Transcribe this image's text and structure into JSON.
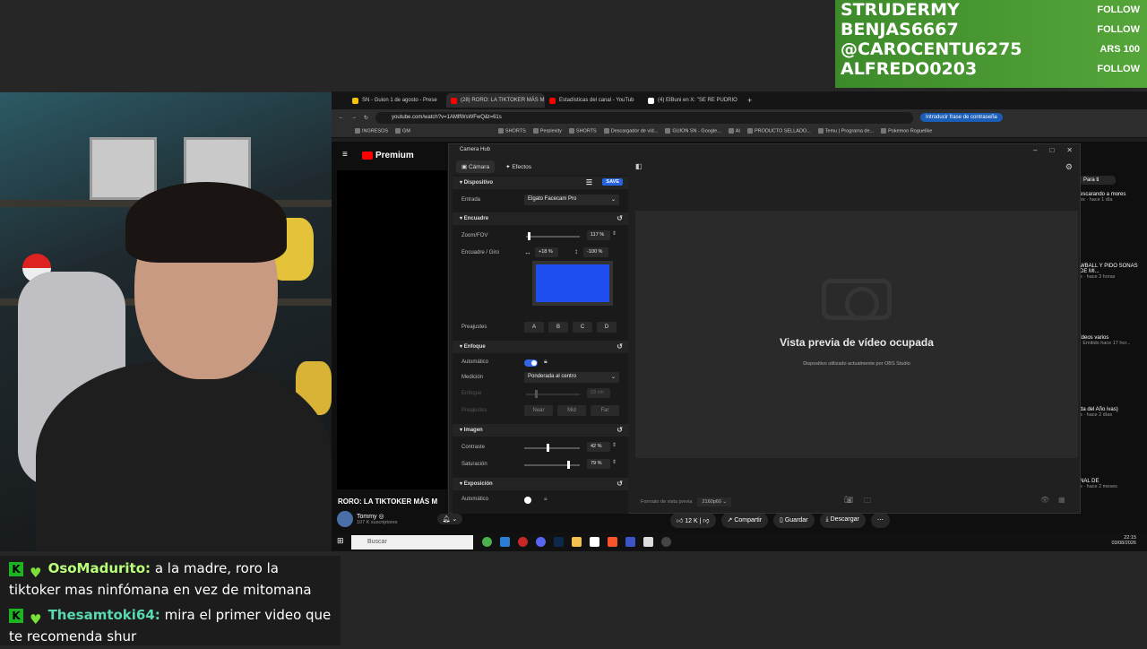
{
  "alerts": [
    {
      "name": "STRUDERMY",
      "action": "FOLLOW"
    },
    {
      "name": "BENJAS6667",
      "action": "FOLLOW"
    },
    {
      "name": "@CAROCENTU6275",
      "action": "ARS 100"
    },
    {
      "name": "ALFREDO0203",
      "action": "FOLLOW"
    }
  ],
  "chat": [
    {
      "badge": "K",
      "user": "OsoMadurito:",
      "msg": "a la madre, roro la tiktoker mas ninfómana en vez de mitomana"
    },
    {
      "badge": "K",
      "user": "Thesamtoki64:",
      "msg": "mira el primer video que te recomenda shur"
    }
  ],
  "browser": {
    "tabs": [
      {
        "label": "SN - Guion 1 de agosto - Prese",
        "color": "#f4c20d"
      },
      {
        "label": "(28) RORO: LA TIKTOKER MÁS M",
        "color": "#ff0000",
        "active": true
      },
      {
        "label": "Estadísticas del canal - YouTub",
        "color": "#ff0000"
      },
      {
        "label": "(4) ElBuni en X: \"SE RE PUDRIO",
        "color": "#ffffff"
      }
    ],
    "url": "youtube.com/watch?v=1AMlfWsWFwQ&t=61s",
    "translate_pill": "Introducir frase de contraseña",
    "bookmarks": [
      "INGRESOS",
      "GM",
      "SHORTS",
      "Perplexity",
      "SHORTS",
      "Descargador de víd...",
      "GUION SN - Google...",
      "AI",
      "PRODUCTO SELLADO...",
      "Temu | Programa de...",
      "Pokemon Roguelike"
    ]
  },
  "youtube": {
    "logo": "Premium",
    "video_title": "RORO: LA TIKTOKER MÁS M",
    "channel": "Tommy ◎",
    "subs": "107 K suscriptores",
    "likes": "12 K",
    "share": "Compartir",
    "save": "Guardar",
    "download": "Descargar",
    "for_you": "Para ti",
    "sidebar": [
      {
        "title": "escarando a mores",
        "meta": "es · hace 1 día"
      },
      {
        "title": "WBALL Y PIDO SONAS DE MI...",
        "meta": "s · hace 3 horas"
      },
      {
        "title": "ídeos varios",
        "meta": "· Emitido hace 17 hor..."
      },
      {
        "title": "da del Año ivas)",
        "meta": "s · hace 2 días"
      },
      {
        "title": "NAL DE",
        "meta": "s · hace 2 meses"
      }
    ]
  },
  "camera_hub": {
    "title": "Camera Hub",
    "tab_camera": "Cámara",
    "tab_effects": "Efectos",
    "section_device": "Dispositivo",
    "save": "SAVE",
    "input_label": "Entrada",
    "input_value": "Elgato Facecam Pro",
    "section_framing": "Encuadre",
    "zoom_label": "Zoom/FOV",
    "zoom_value": "117 %",
    "zoom_level": 0.05,
    "pan_label": "Encuadre / Giro",
    "pan_value": "+18 %",
    "tilt_value": "-100 %",
    "presets_label": "Preajustes",
    "presets": [
      "A",
      "B",
      "C",
      "D"
    ],
    "section_focus": "Enfoque",
    "auto_label": "Automático",
    "metering_label": "Medición",
    "metering_value": "Ponderada al centro",
    "focus_label": "Enfoque",
    "focus_value": "23 cm",
    "focus_presets_label": "Preajustes",
    "focus_presets": [
      "Near",
      "Mid",
      "Far"
    ],
    "section_image": "Imagen",
    "contrast_label": "Contraste",
    "contrast_value": "42 %",
    "contrast_level": 0.42,
    "saturation_label": "Saturación",
    "saturation_value": "79 %",
    "saturation_level": 0.79,
    "section_exposure": "Exposición",
    "exposure_auto_label": "Automático",
    "preview_title": "Vista previa de vídeo ocupada",
    "preview_subtitle": "Dispositivo utilizado actualmente por OBS Studio",
    "format_label": "Formato de vista previa",
    "format_value": "2160p60"
  },
  "taskbar": {
    "search_placeholder": "Buscar",
    "time": "22:15",
    "date": "03/08/2026"
  }
}
